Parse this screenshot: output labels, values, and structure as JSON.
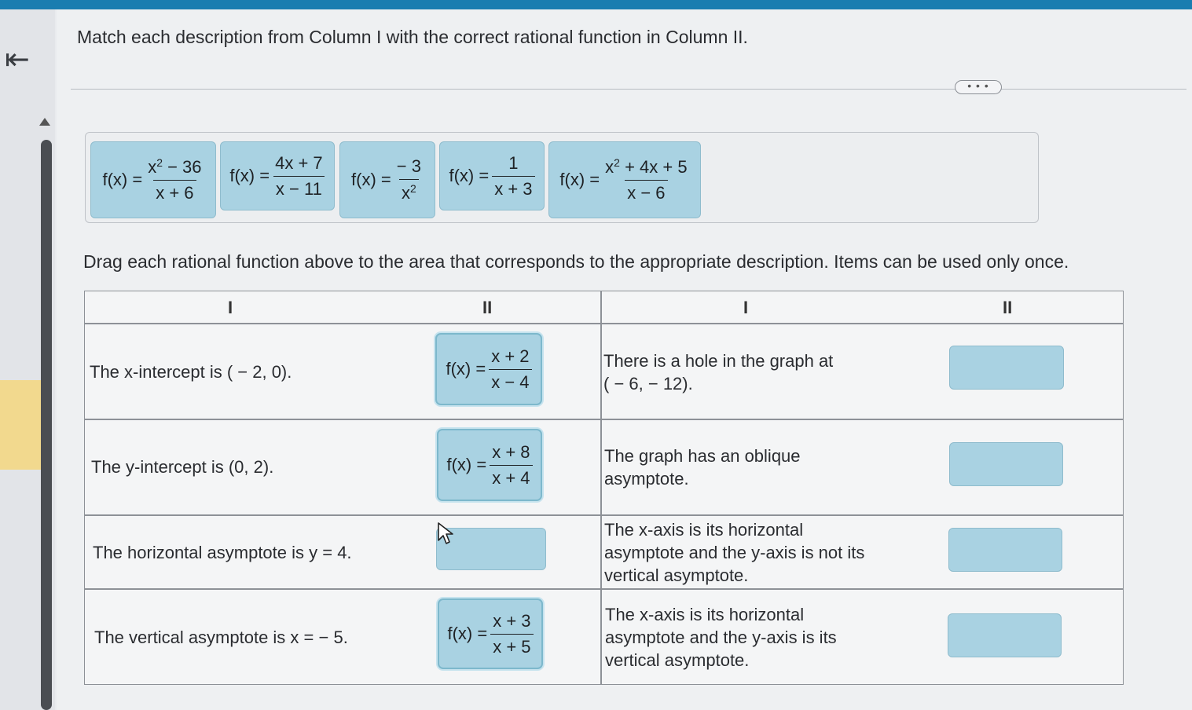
{
  "question": "Match each description from Column I with the correct rational function in Column II.",
  "instruction": "Drag each rational function above to the area that corresponds to the appropriate description. Items can be used only once.",
  "more_label": "• • •",
  "bank": [
    {
      "lhs": "f(x) =",
      "num": "x",
      "num_sup": "2",
      "num_rest": " − 36",
      "den": "x + 6",
      "den_sup": "",
      "den_rest": ""
    },
    {
      "lhs": "f(x) =",
      "num": "4x + 7",
      "num_sup": "",
      "num_rest": "",
      "den": "x − 11",
      "den_sup": "",
      "den_rest": ""
    },
    {
      "lhs": "f(x) =",
      "num": "− 3",
      "num_sup": "",
      "num_rest": "",
      "den": "x",
      "den_sup": "2",
      "den_rest": ""
    },
    {
      "lhs": "f(x) =",
      "num": "1",
      "num_sup": "",
      "num_rest": "",
      "den": "x + 3",
      "den_sup": "",
      "den_rest": ""
    },
    {
      "lhs": "f(x) =",
      "num": "x",
      "num_sup": "2",
      "num_rest": " + 4x + 5",
      "den": "x − 6",
      "den_sup": "",
      "den_rest": ""
    }
  ],
  "table": {
    "headers": [
      "I",
      "II",
      "I",
      "II"
    ],
    "left_rows": [
      {
        "desc": "The x-intercept is ( − 2, 0).",
        "answer": {
          "lhs": "f(x) =",
          "num": "x + 2",
          "den": "x − 4"
        }
      },
      {
        "desc": "The y-intercept is (0, 2).",
        "answer": {
          "lhs": "f(x) =",
          "num": "x + 8",
          "den": "x + 4"
        }
      },
      {
        "desc": "The horizontal asymptote is y = 4.",
        "answer": null
      },
      {
        "desc": "The vertical asymptote is x = − 5.",
        "answer": {
          "lhs": "f(x) =",
          "num": "x + 3",
          "den": "x + 5"
        }
      }
    ],
    "right_rows": [
      {
        "desc_lines": [
          "There is a hole in the graph at",
          "( − 6, − 12)."
        ]
      },
      {
        "desc_lines": [
          "The graph has an oblique",
          "asymptote."
        ]
      },
      {
        "desc_lines": [
          "The x-axis is its horizontal",
          "asymptote and the y-axis is not its",
          "vertical asymptote."
        ]
      },
      {
        "desc_lines": [
          "The x-axis is its horizontal",
          "asymptote and the y-axis is its",
          "vertical asymptote."
        ]
      }
    ]
  },
  "icons": {
    "back": "back-arrow-icon",
    "cursor": "mouse-pointer-icon"
  },
  "colors": {
    "tile": "#a9d2e2",
    "topbar": "#1a7db0"
  }
}
